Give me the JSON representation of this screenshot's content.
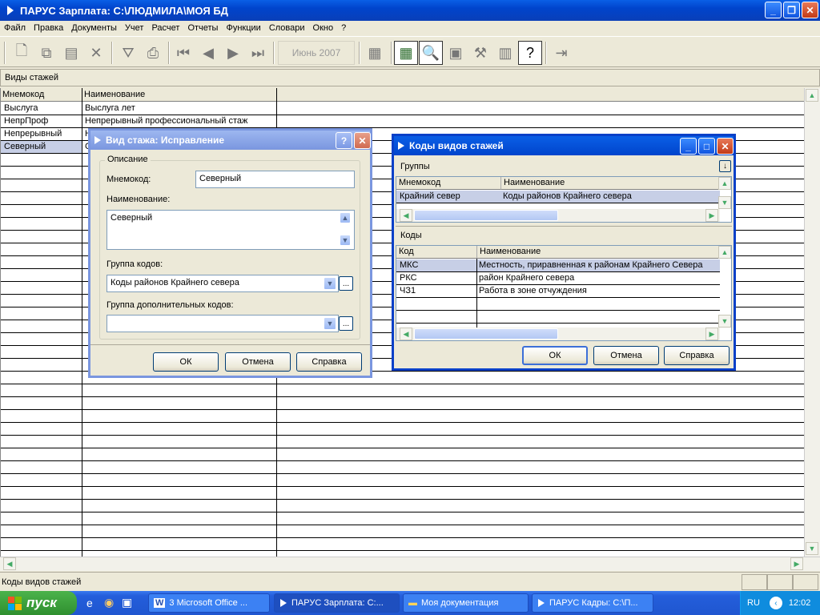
{
  "window": {
    "title": "ПАРУС Зарплата: C:\\ЛЮДМИЛА\\МОЯ БД"
  },
  "menu": [
    "Файл",
    "Правка",
    "Документы",
    "Учет",
    "Расчет",
    "Отчеты",
    "Функции",
    "Словари",
    "Окно",
    "?"
  ],
  "toolbar": {
    "month": "Июнь 2007"
  },
  "subheader": {
    "title": "Виды стажей"
  },
  "grid": {
    "columns": [
      "Мнемокод",
      "Наименование"
    ],
    "rows": [
      {
        "mnemo": "Выслуга",
        "name": "Выслуга лет"
      },
      {
        "mnemo": "НепрПроф",
        "name": "Непрерывный профессиональный стаж"
      },
      {
        "mnemo": "Непрерывный",
        "name": "Н"
      },
      {
        "mnemo": "Северный",
        "name": "С"
      }
    ]
  },
  "statusbar": {
    "text": "Коды видов стажей"
  },
  "dialog_edit": {
    "title": "Вид стажа: Исправление",
    "group_label": "Описание",
    "mnemo_label": "Мнемокод:",
    "mnemo_value": "Северный",
    "name_label": "Наименование:",
    "name_value": "Северный",
    "codegroup_label": "Группа кодов:",
    "codegroup_value": "Коды районов Крайнего севера",
    "addgroup_label": "Группа дополнительных кодов:",
    "addgroup_value": "",
    "ok": "ОК",
    "cancel": "Отмена",
    "help": "Справка",
    "ellipsis": "..."
  },
  "dialog_codes": {
    "title": "Коды видов стажей",
    "groups_label": "Группы",
    "groups_columns": [
      "Мнемокод",
      "Наименование"
    ],
    "groups_rows": [
      {
        "mnemo": "Крайний север",
        "name": "Коды районов Крайнего севера"
      }
    ],
    "codes_label": "Коды",
    "codes_columns": [
      "Код",
      "Наименование"
    ],
    "codes_rows": [
      {
        "code": "МКС",
        "name": "Местность, приравненная к районам Крайнего Севера"
      },
      {
        "code": "РКС",
        "name": "район Крайнего севера"
      },
      {
        "code": "ЧЗ1",
        "name": "Работа в зоне отчуждения"
      }
    ],
    "ok": "ОК",
    "cancel": "Отмена",
    "help": "Справка"
  },
  "taskbar": {
    "start": "пуск",
    "tasks": [
      "3 Microsoft Office ...",
      "ПАРУС Зарплата: C:...",
      "Моя документация",
      "ПАРУС Кадры: C:\\П..."
    ],
    "lang": "RU",
    "time": "12:02"
  }
}
